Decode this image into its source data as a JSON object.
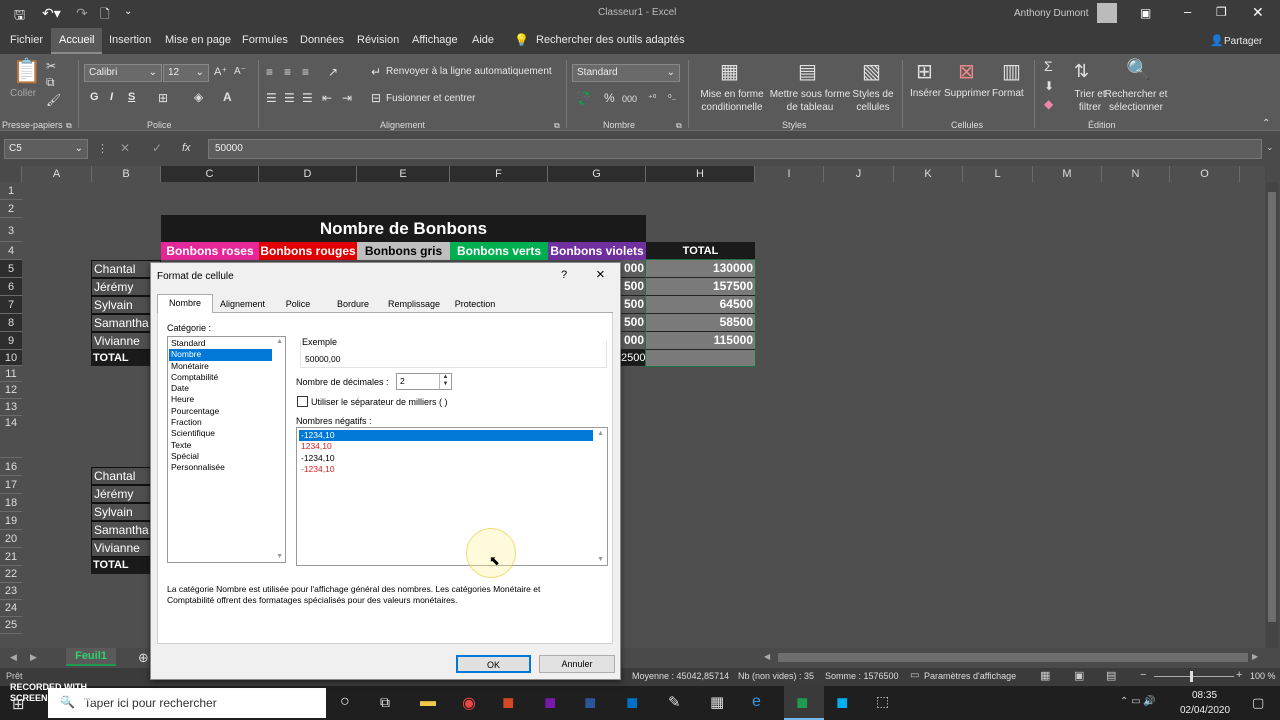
{
  "window": {
    "title": "Classeur1 - Excel",
    "user": "Anthony Dumont"
  },
  "menu": {
    "items": [
      "Fichier",
      "Accueil",
      "Insertion",
      "Mise en page",
      "Formules",
      "Données",
      "Révision",
      "Affichage",
      "Aide"
    ],
    "tellme": "Rechercher des outils adaptés",
    "share": "Partager"
  },
  "ribbon": {
    "clipboard": {
      "paste": "Coller",
      "label": "Presse-papiers"
    },
    "font": {
      "name": "Calibri",
      "size": "12",
      "label": "Police",
      "bold": "G",
      "italic": "I",
      "underline": "S"
    },
    "alignment": {
      "wrap": "Renvoyer à la ligne automatiquement",
      "merge": "Fusionner et centrer",
      "label": "Alignement"
    },
    "number": {
      "format": "Standard",
      "label": "Nombre"
    },
    "styles": {
      "cond": "Mise en forme conditionnelle",
      "table": "Mettre sous forme de tableau",
      "cell": "Styles de cellules",
      "label": "Styles"
    },
    "cells": {
      "insert": "Insérer",
      "delete": "Supprimer",
      "format": "Format",
      "label": "Cellules"
    },
    "editing": {
      "sort": "Trier et filtrer",
      "find": "Rechercher et sélectionner",
      "label": "Édition"
    }
  },
  "formula": {
    "namebox": "C5",
    "fx": "fx",
    "value": "50000"
  },
  "grid": {
    "columns": [
      "A",
      "B",
      "C",
      "D",
      "E",
      "F",
      "G",
      "H",
      "I",
      "J",
      "K",
      "L",
      "M",
      "N",
      "O"
    ],
    "rows": [
      "1",
      "2",
      "3",
      "4",
      "5",
      "6",
      "7",
      "8",
      "9",
      "10",
      "11",
      "12",
      "13",
      "14",
      "16",
      "17",
      "18",
      "19",
      "20",
      "21",
      "22",
      "23",
      "24",
      "25"
    ],
    "title": "Nombre de Bonbons",
    "headers": {
      "roses": "Bonbons roses",
      "rouges": "Bonbons rouges",
      "gris": "Bonbons gris",
      "verts": "Bonbons verts",
      "violets": "Bonbons violets",
      "total": "TOTAL"
    },
    "names": [
      "Chantal",
      "Jérémy",
      "Sylvain",
      "Samantha",
      "Vivianne",
      "TOTAL"
    ],
    "names2": [
      "Chantal",
      "Jérémy",
      "Sylvain",
      "Samantha",
      "Vivianne",
      "TOTAL"
    ],
    "g_visible": [
      "000",
      "500",
      "500",
      "500",
      "000",
      "2500"
    ],
    "totals": [
      "130000",
      "157500",
      "64500",
      "58500",
      "115000"
    ]
  },
  "sheet": {
    "tab": "Feuil1"
  },
  "status": {
    "ready": "Prêt",
    "avg": "Moyenne : 45042,85714",
    "count": "Nb (non vides) : 35",
    "sum": "Somme : 1576500",
    "display": "Paramètres d'affichage",
    "zoom": "100 %"
  },
  "taskbar": {
    "search": "Taper ici pour rechercher",
    "time": "08:35",
    "date": "02/04/2020",
    "watermark": "RECORDED WITH SCREENCAST-O-MATIC"
  },
  "dialog": {
    "title": "Format de cellule",
    "help": "?",
    "close": "×",
    "tabs": [
      "Nombre",
      "Alignement",
      "Police",
      "Bordure",
      "Remplissage",
      "Protection"
    ],
    "category_label": "Catégorie :",
    "categories": [
      "Standard",
      "Nombre",
      "Monétaire",
      "Comptabilité",
      "Date",
      "Heure",
      "Pourcentage",
      "Fraction",
      "Scientifique",
      "Texte",
      "Spécial",
      "Personnalisée"
    ],
    "example_label": "Exemple",
    "example_value": "50000,00",
    "decimals_label": "Nombre de décimales :",
    "decimals_value": "2",
    "separator_label": "Utiliser le séparateur de milliers ( )",
    "negative_label": "Nombres négatifs :",
    "negatives": [
      "-1234,10",
      "1234,10",
      "-1234,10",
      "-1234,10"
    ],
    "description": "La catégorie Nombre est utilisée pour l'affichage général des nombres. Les catégories Monétaire et Comptabilité offrent des formatages spécialisés pour des valeurs monétaires.",
    "ok": "OK",
    "cancel": "Annuler"
  },
  "colors": {
    "pink": "#e6279a",
    "red": "#e00000",
    "gray": "#bfbfbf",
    "green": "#00b050",
    "violet": "#7030a0",
    "dark": "#1a1a1a",
    "accent": "#0078d7"
  }
}
